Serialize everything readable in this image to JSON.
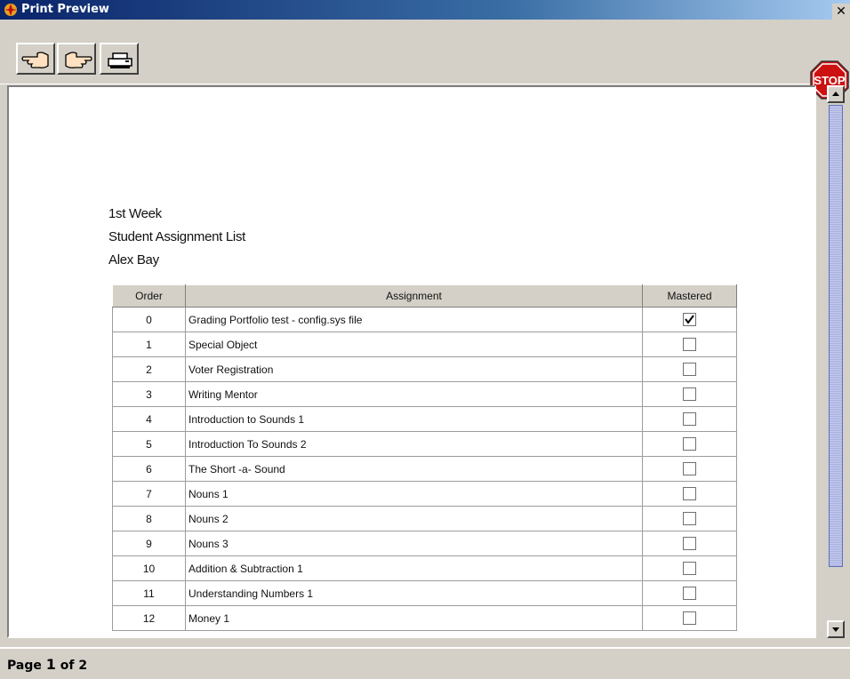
{
  "window": {
    "title": "Print Preview",
    "close_glyph": "✕"
  },
  "toolbar": {
    "buttons": [
      {
        "name": "previous-page-button",
        "icon": "hand-pointing-left-icon"
      },
      {
        "name": "next-page-button",
        "icon": "hand-pointing-right-icon"
      },
      {
        "name": "print-button",
        "icon": "printer-icon"
      }
    ],
    "stop_label": "STOP"
  },
  "document": {
    "heading_lines": [
      "1st Week",
      "Student Assignment List",
      "Alex Bay"
    ],
    "table": {
      "columns": [
        "Order",
        "Assignment",
        "Mastered"
      ],
      "rows": [
        {
          "order": "0",
          "assignment": "Grading Portfolio test - config.sys file",
          "mastered": true
        },
        {
          "order": "1",
          "assignment": "Special Object",
          "mastered": false
        },
        {
          "order": "2",
          "assignment": "Voter Registration",
          "mastered": false
        },
        {
          "order": "3",
          "assignment": "Writing Mentor",
          "mastered": false
        },
        {
          "order": "4",
          "assignment": "Introduction to Sounds 1",
          "mastered": false
        },
        {
          "order": "5",
          "assignment": "Introduction To Sounds 2",
          "mastered": false
        },
        {
          "order": "6",
          "assignment": "The Short -a- Sound",
          "mastered": false
        },
        {
          "order": "7",
          "assignment": "Nouns 1",
          "mastered": false
        },
        {
          "order": "8",
          "assignment": "Nouns 2",
          "mastered": false
        },
        {
          "order": "9",
          "assignment": "Nouns 3",
          "mastered": false
        },
        {
          "order": "10",
          "assignment": "Addition & Subtraction 1",
          "mastered": false
        },
        {
          "order": "11",
          "assignment": "Understanding Numbers 1",
          "mastered": false
        },
        {
          "order": "12",
          "assignment": "Money 1",
          "mastered": false
        }
      ]
    }
  },
  "status": {
    "prefix": "Page",
    "page": "1",
    "of": "of",
    "total": "2"
  },
  "colors": {
    "title_start": "#0a246a",
    "title_end": "#a6caf0",
    "stop_red": "#cc1111"
  }
}
